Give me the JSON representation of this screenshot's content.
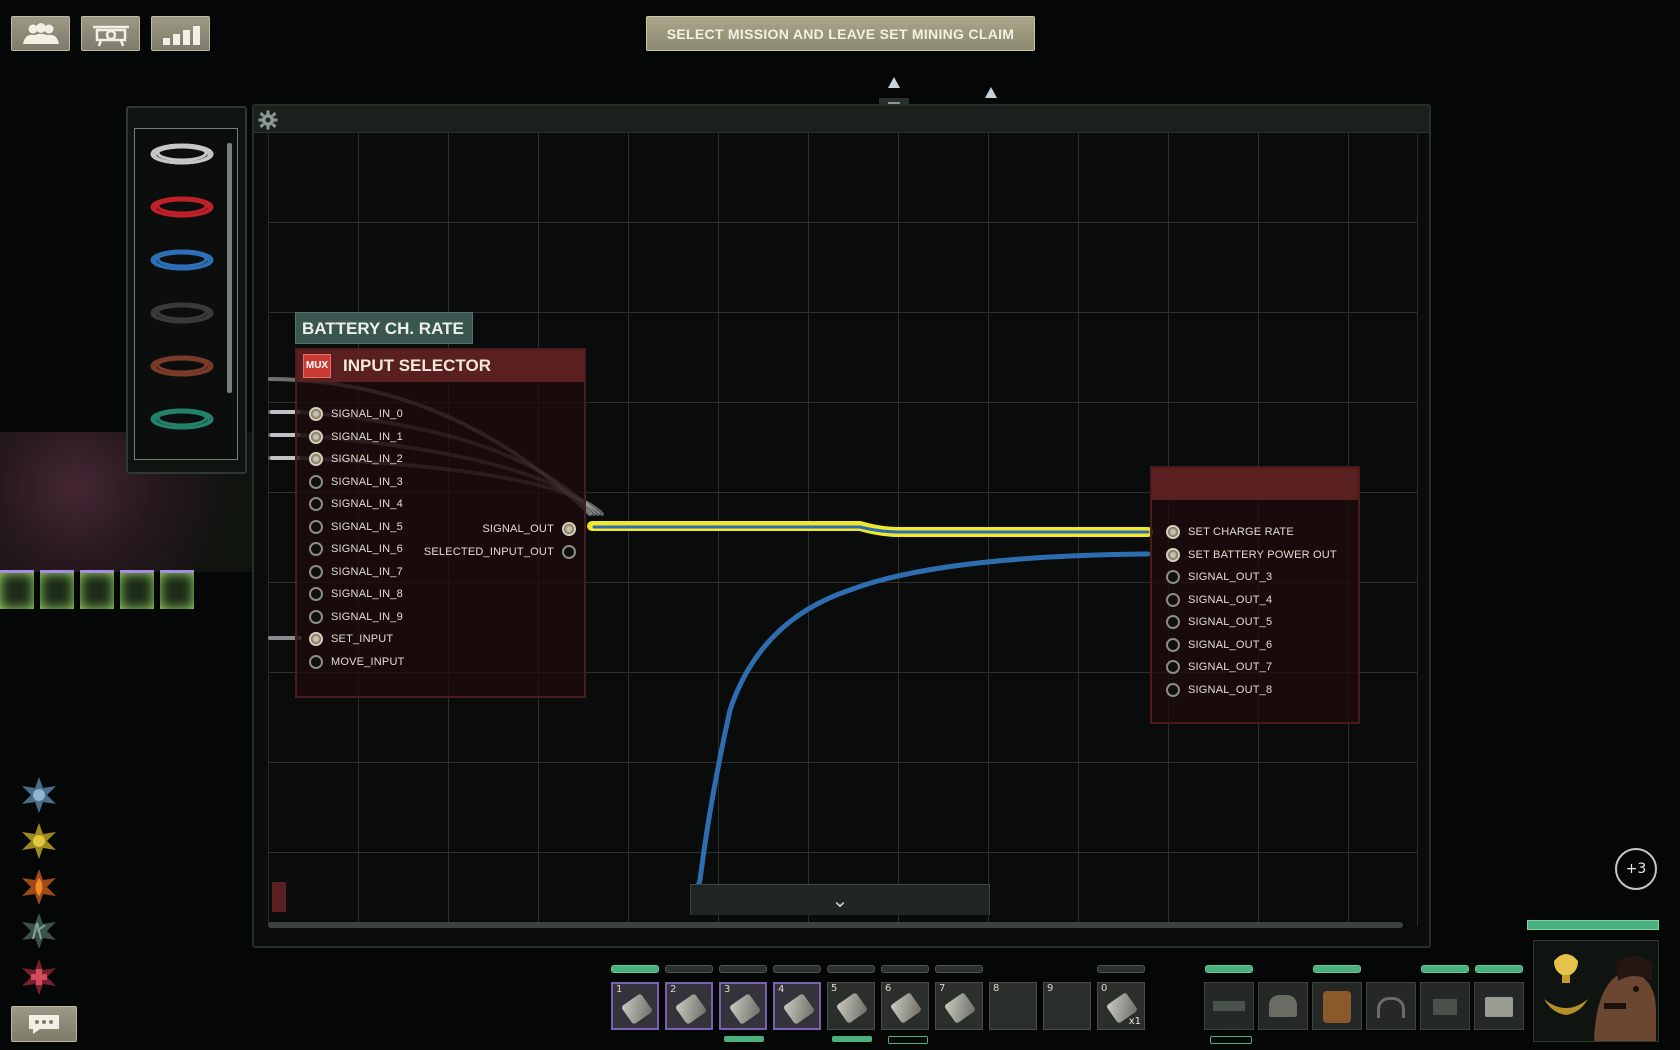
{
  "top_buttons": [
    {
      "icon": "crew-icon"
    },
    {
      "icon": "command-icon"
    },
    {
      "icon": "stats-icon"
    }
  ],
  "mission_button": {
    "label": "SELECT MISSION AND LEAVE SET MINING CLAIM"
  },
  "wire_inventory": {
    "wires": [
      {
        "color": "#c7c7c7",
        "name": "gray-wire"
      },
      {
        "color": "#c0202a",
        "name": "red-wire"
      },
      {
        "color": "#2e6fb8",
        "name": "blue-wire"
      },
      {
        "color": "#3a3a3a",
        "name": "black-wire"
      },
      {
        "color": "#7a3b2a",
        "name": "brown-wire"
      },
      {
        "color": "#22826a",
        "name": "green-wire"
      }
    ]
  },
  "editor": {
    "label_component": {
      "text": "BATTERY CH. RATE"
    },
    "input_selector": {
      "badge": "MUX",
      "title": "INPUT SELECTOR",
      "inputs": [
        "SIGNAL_IN_0",
        "SIGNAL_IN_1",
        "SIGNAL_IN_2",
        "SIGNAL_IN_3",
        "SIGNAL_IN_4",
        "SIGNAL_IN_5",
        "SIGNAL_IN_6",
        "SIGNAL_IN_7",
        "SIGNAL_IN_8",
        "SIGNAL_IN_9",
        "SET_INPUT",
        "MOVE_INPUT"
      ],
      "outputs": [
        "SIGNAL_OUT",
        "SELECTED_INPUT_OUT"
      ]
    },
    "right_component": {
      "title": "",
      "pins": [
        "SET CHARGE RATE",
        "SET BATTERY POWER OUT",
        "SIGNAL_OUT_3",
        "SIGNAL_OUT_4",
        "SIGNAL_OUT_5",
        "SIGNAL_OUT_6",
        "SIGNAL_OUT_7",
        "SIGNAL_OUT_8"
      ]
    },
    "collapse_icon": "chevron-down-icon"
  },
  "notification_badge": "+3",
  "hotbar": {
    "slots": [
      {
        "num": "1",
        "icon": "screwdriver-icon",
        "count": ""
      },
      {
        "num": "2",
        "icon": "wrench-icon",
        "count": ""
      },
      {
        "num": "3",
        "icon": "rifle-icon",
        "count": ""
      },
      {
        "num": "4",
        "icon": "screwdriver-icon",
        "count": ""
      },
      {
        "num": "5",
        "icon": "diving-mask-icon",
        "count": ""
      },
      {
        "num": "6",
        "icon": "flashlight-icon",
        "count": ""
      },
      {
        "num": "7",
        "icon": "watering-can-icon",
        "count": ""
      },
      {
        "num": "8",
        "icon": "",
        "count": ""
      },
      {
        "num": "9",
        "icon": "",
        "count": ""
      },
      {
        "num": "0",
        "icon": "syringe-icon",
        "count": "x1"
      }
    ]
  },
  "colors": {
    "yellow_wire": "#f2e82a",
    "blue_wire": "#2d6db0",
    "gray_wire": "#bfc3c6"
  }
}
